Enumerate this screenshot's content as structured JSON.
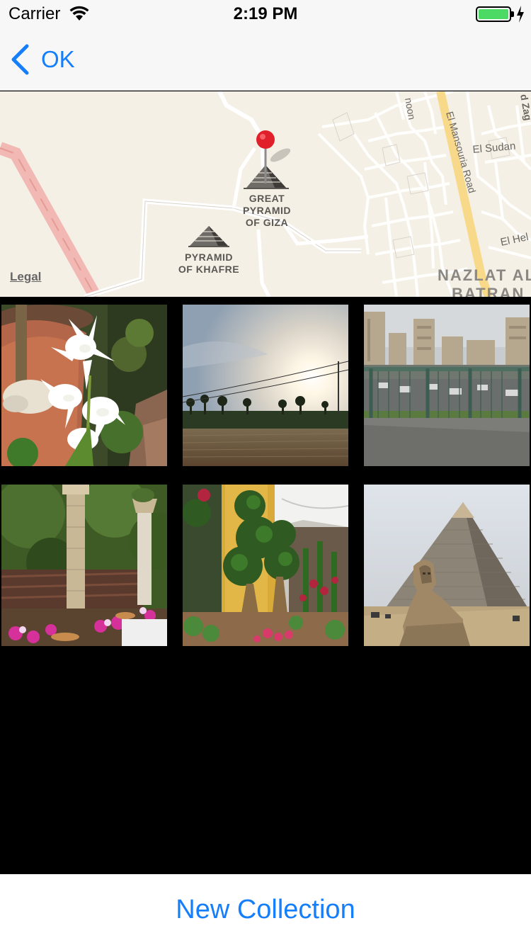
{
  "status_bar": {
    "carrier": "Carrier",
    "time": "2:19 PM",
    "battery_level": 1.0
  },
  "nav": {
    "back_label": "OK"
  },
  "map": {
    "labels": {
      "great_pyramid": "GREAT\nPYRAMID\nOF GIZA",
      "khafre": "PYRAMID\nOF KHAFRE",
      "road": "El Mansouria Road",
      "sudan": "El Sudan",
      "nazlat": "NAZLAT AL",
      "batran": "BATRAN",
      "hel": "El Hel",
      "noon": "noon",
      "zag": "d Zag"
    },
    "legal": "Legal"
  },
  "photos": [
    {
      "subject": "white lilies in flower pot"
    },
    {
      "subject": "sunset over field"
    },
    {
      "subject": "city street behind railing"
    },
    {
      "subject": "garden with pillars and flowers"
    },
    {
      "subject": "plants at garden exhibition"
    },
    {
      "subject": "sphinx and pyramid"
    }
  ],
  "bottom": {
    "new_collection_label": "New Collection"
  },
  "colors": {
    "accent": "#147efb",
    "battery": "#4cd964",
    "pin": "#e0202a"
  }
}
